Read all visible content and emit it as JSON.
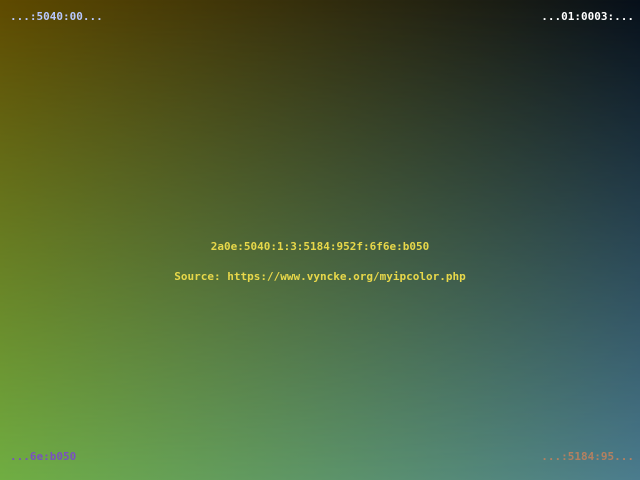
{
  "colors": {
    "top_left": "#5f4a00",
    "top_right": "#07101a",
    "bottom_left": "#70ae42",
    "bottom_right": "#4b7c8e",
    "center_text": "#e8d84a",
    "tl_text": "#b8c8ff",
    "tr_text": "#ffffff",
    "bl_text": "#7a50c0",
    "br_text": "#b48060"
  },
  "corners": {
    "top_left": "...:5040:00...",
    "top_right": "...01:0003:...",
    "bottom_left": "...6e:b050",
    "bottom_right": "...:5184:95..."
  },
  "center": {
    "ip": "2a0e:5040:1:3:5184:952f:6f6e:b050",
    "source": "Source: https://www.vyncke.org/myipcolor.php"
  }
}
